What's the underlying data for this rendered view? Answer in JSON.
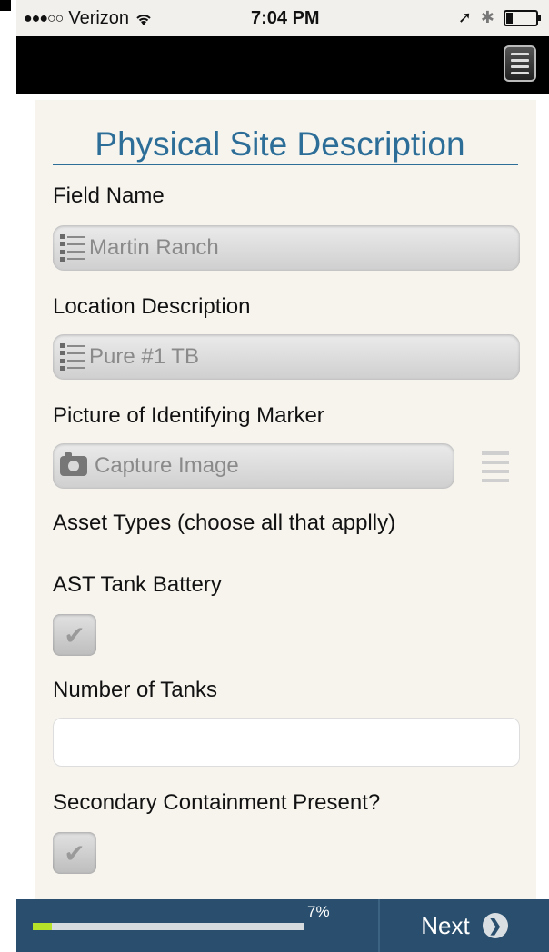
{
  "status_bar": {
    "carrier": "Verizon",
    "time": "7:04 PM",
    "signal_dots": "●●●○○",
    "wifi_icon": "wifi-icon",
    "location_icon": "location-arrow-icon",
    "bluetooth_icon": "bluetooth-icon",
    "battery_level": 0.2
  },
  "nav": {
    "menu_icon": "hamburger-menu-icon"
  },
  "form": {
    "title": "Physical Site Description",
    "field_name_label": "Field Name",
    "field_name_value": "Martin Ranch",
    "location_label": "Location Description",
    "location_value": "Pure #1 TB",
    "picture_label": "Picture of Identifying Marker",
    "capture_label": "Capture Image",
    "asset_types_label": "Asset Types (choose all that applly)",
    "ast_label": "AST Tank Battery",
    "ast_checked": true,
    "tanks_label": "Number of Tanks",
    "tanks_value": "",
    "secondary_label": "Secondary Containment Present?",
    "secondary_checked": true
  },
  "footer": {
    "progress_percent": 7,
    "progress_text": "7%",
    "next_label": "Next"
  },
  "colors": {
    "accent": "#2c6e98",
    "footer_bg": "#2a4f6e",
    "progress_fill": "#b6e22a",
    "content_bg": "#f7f4ee"
  }
}
